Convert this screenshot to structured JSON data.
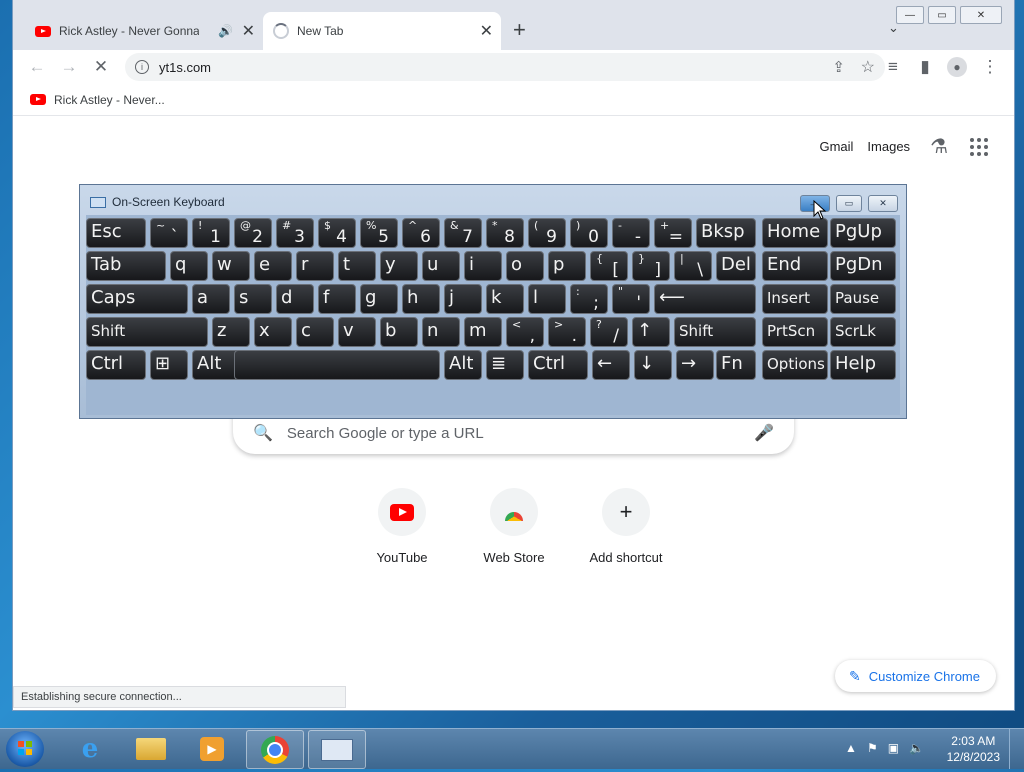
{
  "browser": {
    "tabs": [
      {
        "title": "Rick Astley - Never Gonna Give You Up",
        "audio": true
      },
      {
        "title": "New Tab",
        "loading": true
      }
    ],
    "new_tab_symbol": "+",
    "address": "yt1s.com",
    "bookmarks": [
      {
        "label": "Rick Astley - Never..."
      }
    ],
    "status_text": "Establishing secure connection..."
  },
  "newtab": {
    "top_links": [
      "Gmail",
      "Images"
    ],
    "search_placeholder": "Search Google or type a URL",
    "shortcuts": [
      {
        "label": "YouTube"
      },
      {
        "label": "Web Store"
      },
      {
        "label": "Add shortcut"
      }
    ],
    "customize_label": "Customize Chrome"
  },
  "osk": {
    "title": "On-Screen Keyboard",
    "rows": [
      [
        {
          "t": "Esc"
        },
        {
          "s": "~",
          "m": "`"
        },
        {
          "s": "!",
          "m": "1"
        },
        {
          "s": "@",
          "m": "2"
        },
        {
          "s": "#",
          "m": "3"
        },
        {
          "s": "$",
          "m": "4"
        },
        {
          "s": "%",
          "m": "5"
        },
        {
          "s": "^",
          "m": "6"
        },
        {
          "s": "&",
          "m": "7"
        },
        {
          "s": "*",
          "m": "8"
        },
        {
          "s": "(",
          "m": "9"
        },
        {
          "s": ")",
          "m": "0"
        },
        {
          "s": "-",
          "m": "-"
        },
        {
          "s": "+",
          "m": "="
        },
        {
          "t": "Bksp"
        },
        {
          "t": "Home"
        },
        {
          "t": "PgUp"
        }
      ],
      [
        {
          "t": "Tab"
        },
        {
          "t": "q"
        },
        {
          "t": "w"
        },
        {
          "t": "e"
        },
        {
          "t": "r"
        },
        {
          "t": "t"
        },
        {
          "t": "y"
        },
        {
          "t": "u"
        },
        {
          "t": "i"
        },
        {
          "t": "o"
        },
        {
          "t": "p"
        },
        {
          "s": "{",
          "m": "["
        },
        {
          "s": "}",
          "m": "]"
        },
        {
          "s": "|",
          "m": "\\"
        },
        {
          "t": "Del"
        },
        {
          "t": "End"
        },
        {
          "t": "PgDn"
        }
      ],
      [
        {
          "t": "Caps"
        },
        {
          "t": "a"
        },
        {
          "t": "s"
        },
        {
          "t": "d"
        },
        {
          "t": "f"
        },
        {
          "t": "g"
        },
        {
          "t": "h"
        },
        {
          "t": "j"
        },
        {
          "t": "k"
        },
        {
          "t": "l"
        },
        {
          "s": ":",
          "m": ";"
        },
        {
          "s": "\"",
          "m": "'"
        },
        {
          "t": "⟵"
        },
        {
          "t": "Insert"
        },
        {
          "t": "Pause"
        }
      ],
      [
        {
          "t": "Shift"
        },
        {
          "t": "z"
        },
        {
          "t": "x"
        },
        {
          "t": "c"
        },
        {
          "t": "v"
        },
        {
          "t": "b"
        },
        {
          "t": "n"
        },
        {
          "t": "m"
        },
        {
          "s": "<",
          "m": ","
        },
        {
          "s": ">",
          "m": "."
        },
        {
          "s": "?",
          "m": "/"
        },
        {
          "t": "↑"
        },
        {
          "t": "Shift"
        },
        {
          "t": "PrtScn"
        },
        {
          "t": "ScrLk"
        }
      ],
      [
        {
          "t": "Ctrl"
        },
        {
          "t": "⊞"
        },
        {
          "t": "Alt"
        },
        {
          "t": ""
        },
        {
          "t": "Alt"
        },
        {
          "t": "≣"
        },
        {
          "t": "Ctrl"
        },
        {
          "t": "←"
        },
        {
          "t": "↓"
        },
        {
          "t": "→"
        },
        {
          "t": "Fn"
        },
        {
          "t": "Options"
        },
        {
          "t": "Help"
        }
      ]
    ]
  },
  "taskbar": {
    "apps": [
      "internet-explorer",
      "file-explorer",
      "media-player",
      "chrome",
      "on-screen-keyboard"
    ],
    "time": "2:03 AM",
    "date": "12/8/2023"
  },
  "colors": {
    "accent": "#1a73e8",
    "youtube_red": "#ff0000"
  }
}
